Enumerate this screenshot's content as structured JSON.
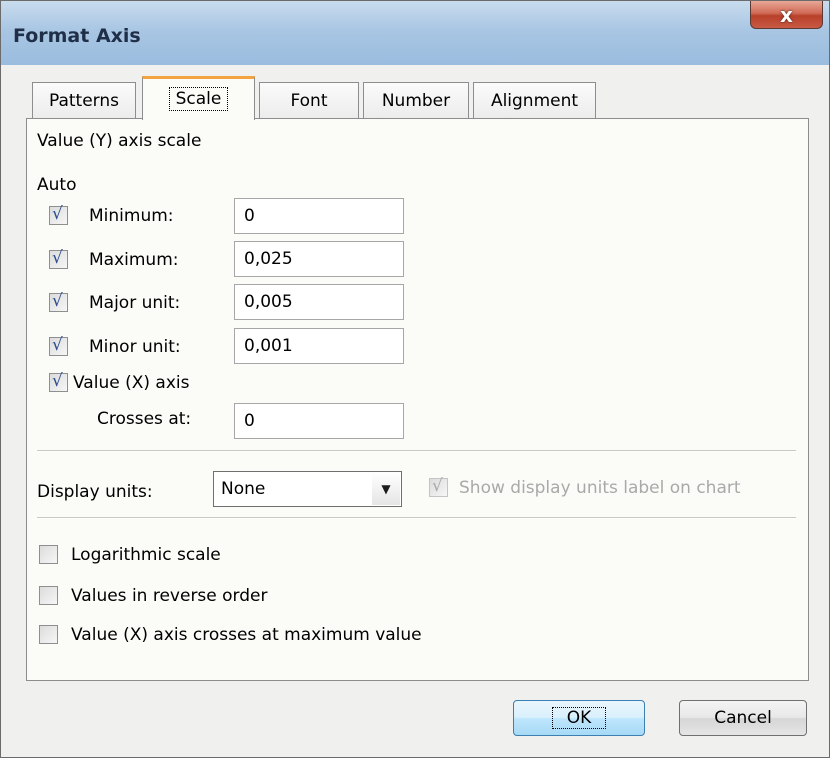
{
  "window": {
    "title": "Format Axis",
    "close_glyph": "x",
    "close_icon": "close-icon"
  },
  "tabs": [
    {
      "label": "Patterns"
    },
    {
      "label": "Scale",
      "active": true
    },
    {
      "label": "Font"
    },
    {
      "label": "Number"
    },
    {
      "label": "Alignment"
    }
  ],
  "scale": {
    "heading": "Value (Y) axis scale",
    "auto_label": "Auto",
    "fields": [
      {
        "label": "Minimum:",
        "value": "0",
        "checked": true
      },
      {
        "label": "Maximum:",
        "value": "0,025",
        "checked": true
      },
      {
        "label": "Major unit:",
        "value": "0,005",
        "checked": true
      },
      {
        "label": "Minor unit:",
        "value": "0,001",
        "checked": true
      }
    ],
    "x_axis_label": "Value (X) axis",
    "crosses_at_label": "Crosses at:",
    "crosses_at_value": "0",
    "display_units_label": "Display units:",
    "display_units_value": "None",
    "show_units_label": "Show display units label on chart",
    "options": [
      {
        "label": "Logarithmic scale",
        "checked": false
      },
      {
        "label": "Values in reverse order",
        "checked": false
      },
      {
        "label": "Value (X) axis crosses at maximum value",
        "checked": false
      }
    ]
  },
  "buttons": {
    "ok": "OK",
    "cancel": "Cancel"
  },
  "colors": {
    "title_bar": "#a9c6e3",
    "active_tab_accent": "#f3a440",
    "check_mark": "#2b4c8c"
  }
}
